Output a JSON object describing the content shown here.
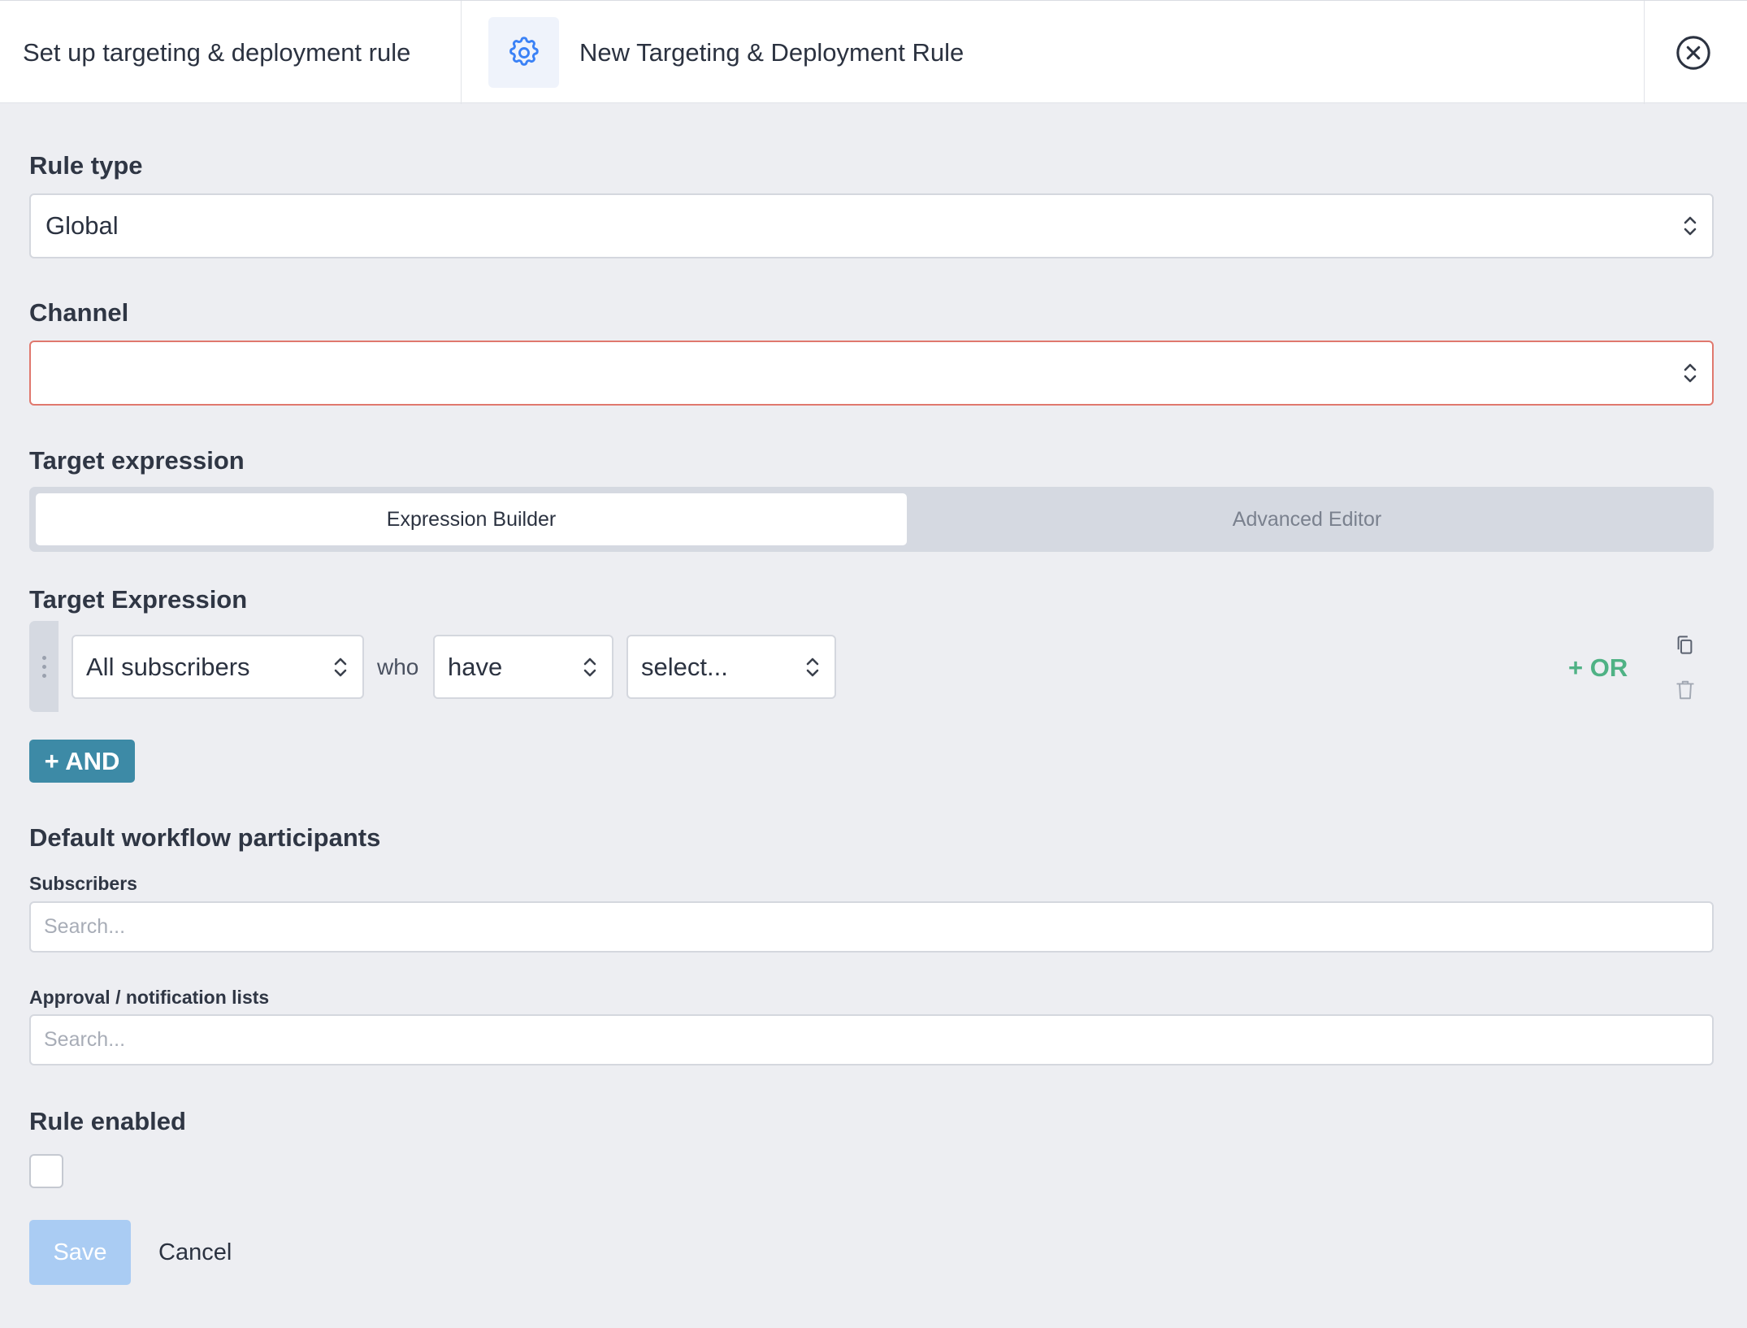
{
  "header": {
    "breadcrumb": "Set up targeting & deployment rule",
    "title": "New Targeting & Deployment Rule",
    "icon": "gear-icon",
    "close_icon": "close-circle-icon"
  },
  "rule_type": {
    "label": "Rule type",
    "value": "Global"
  },
  "channel": {
    "label": "Channel",
    "value": ""
  },
  "target_expression": {
    "label": "Target expression",
    "tabs": [
      {
        "label": "Expression Builder",
        "active": true
      },
      {
        "label": "Advanced Editor",
        "active": false
      }
    ]
  },
  "expression_builder": {
    "label": "Target Expression",
    "subject": "All subscribers",
    "connector": "who",
    "verb": "have",
    "condition": "select...",
    "or_label": "+ OR",
    "and_label": "+ AND"
  },
  "participants": {
    "label": "Default workflow participants",
    "subscribers_label": "Subscribers",
    "subscribers_placeholder": "Search...",
    "lists_label": "Approval / notification lists",
    "lists_placeholder": "Search..."
  },
  "rule_enabled": {
    "label": "Rule enabled",
    "checked": false
  },
  "actions": {
    "save": "Save",
    "cancel": "Cancel"
  },
  "colors": {
    "accent_green": "#4fb285",
    "and_button": "#3d8aa6",
    "save_disabled": "#aaccf3",
    "error_border": "#e0786e"
  }
}
